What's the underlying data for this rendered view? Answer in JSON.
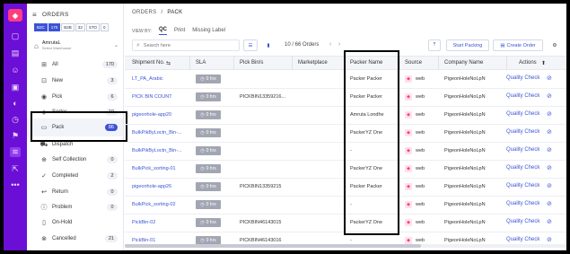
{
  "rail": {
    "icons": [
      "logo-icon",
      "home-icon",
      "inventory-icon",
      "users-icon",
      "orders-icon",
      "dashboard-icon",
      "clock-icon",
      "flag-icon",
      "stack-icon",
      "export-icon",
      "more-icon"
    ]
  },
  "panel": {
    "title": "ORDERS",
    "chips": [
      "B2C",
      "170",
      "B2B",
      "33",
      "STO",
      "0"
    ],
    "warehouse": {
      "name": "AmrutaL",
      "sub": "Select Warehouse"
    },
    "statuses": [
      {
        "label": "All",
        "count": "170",
        "icon": "grid-icon"
      },
      {
        "label": "New",
        "count": "3",
        "icon": "new-icon"
      },
      {
        "label": "Pick",
        "count": "6",
        "icon": "pick-icon"
      },
      {
        "label": "Sorter",
        "count": "19",
        "icon": "sorter-icon"
      },
      {
        "label": "Pack",
        "count": "86",
        "icon": "pack-icon"
      },
      {
        "label": "Dispatch",
        "count": "",
        "icon": "truck-icon"
      },
      {
        "label": "Self Collection",
        "count": "0",
        "icon": "collection-icon"
      },
      {
        "label": "Completed",
        "count": "2",
        "icon": "check-icon"
      },
      {
        "label": "Return",
        "count": "0",
        "icon": "return-icon"
      },
      {
        "label": "Problem",
        "count": "0",
        "icon": "warning-icon"
      },
      {
        "label": "On-Hold",
        "count": "",
        "icon": "hold-icon"
      },
      {
        "label": "Cancelled",
        "count": "21",
        "icon": "cancel-icon"
      }
    ]
  },
  "main": {
    "breadcrumb": {
      "root": "ORDERS",
      "sep": "/",
      "current": "PACK"
    },
    "view_by_label": "VIEW BY:",
    "tabs": [
      "QC",
      "Print",
      "Missing Label"
    ],
    "search_placeholder": "Search here",
    "count_text": "10 / 66 Orders",
    "start_packing": "Start Packing",
    "create_order": "Create Order"
  },
  "table": {
    "headers": [
      "Shipment No.",
      "SLA",
      "Pick Bin/s",
      "Marketplace",
      "Packer Name",
      "Source",
      "Company Name",
      "Actions"
    ],
    "rows": [
      {
        "shipment": "LT_PA_Arabic",
        "sla": "0 hrs",
        "bin": "",
        "packer": "Packer Packer",
        "source": "web",
        "company": "PigeonHoleNoLpN",
        "action": "Quality Check"
      },
      {
        "shipment": "PICK BIN COUNT",
        "sla": "0 hrs",
        "bin": "PICKBIN13359216...",
        "packer": "Packer Packer",
        "source": "web",
        "company": "PigeonHoleNoLpN",
        "action": "Quality Check"
      },
      {
        "shipment": "pigeonhole-app20",
        "sla": "0 hrs",
        "bin": "",
        "packer": "Amruta Londhe",
        "source": "web",
        "company": "PigeonHoleNoLpN",
        "action": "Quality Check"
      },
      {
        "shipment": "BulkPikByLoctn_Bin-...",
        "sla": "0 hrs",
        "bin": "",
        "packer": "PackerYZ One",
        "source": "web",
        "company": "PigeonHoleNoLpN",
        "action": "Quality Check"
      },
      {
        "shipment": "BulkPikByLoctn_Bin-...",
        "sla": "0 hrs",
        "bin": "",
        "packer": "-",
        "source": "web",
        "company": "PigeonHoleNoLpN",
        "action": "Quality Check"
      },
      {
        "shipment": "BulkPick_sorting-01",
        "sla": "0 hrs",
        "bin": "",
        "packer": "PackerYZ One",
        "source": "web",
        "company": "PigeonHoleNoLpN",
        "action": "Quality Check"
      },
      {
        "shipment": "pigeonhole-app26",
        "sla": "0 hrs",
        "bin": "PICKBIN13359215",
        "packer": "Packer Packer",
        "source": "web",
        "company": "PigeonHoleNoLpN",
        "action": "Quality Check"
      },
      {
        "shipment": "BulkPick_sorting-02",
        "sla": "0 hrs",
        "bin": "",
        "packer": "-",
        "source": "web",
        "company": "PigeonHoleNoLpN",
        "action": "Quality Check"
      },
      {
        "shipment": "PickBin-02",
        "sla": "0 hrs",
        "bin": "PICKBIN46143015",
        "packer": "PackerYZ One",
        "source": "web",
        "company": "PigeonHoleNoLpN",
        "action": "Quality Check"
      },
      {
        "shipment": "PickBin-01",
        "sla": "0 hrs",
        "bin": "PICKBIN46143016",
        "packer": "-",
        "source": "web",
        "company": "PigeonHoleNoLpN",
        "action": "Quality Check"
      }
    ]
  },
  "colors": {
    "brand": "#6b0fd6",
    "accent": "#3b53d6",
    "source": "#ff3d7f"
  }
}
